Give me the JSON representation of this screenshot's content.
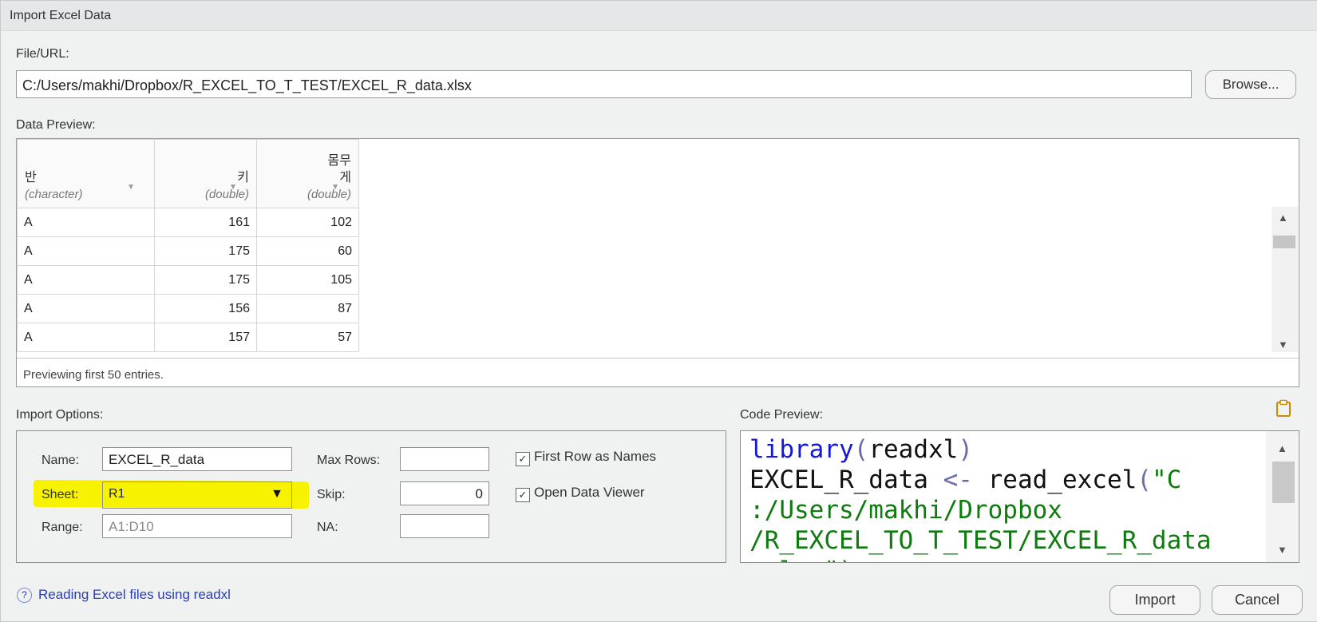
{
  "window": {
    "title": "Import Excel Data"
  },
  "file": {
    "label": "File/URL:",
    "value": "C:/Users/makhi/Dropbox/R_EXCEL_TO_T_TEST/EXCEL_R_data.xlsx",
    "browse_label": "Browse..."
  },
  "preview": {
    "label": "Data Preview:",
    "columns": [
      {
        "name": "반",
        "type": "(character)"
      },
      {
        "name": "키",
        "type": "(double)"
      },
      {
        "name": "몸무게",
        "name_line1": "몸무",
        "name_line2": "게",
        "type": "(double)"
      }
    ],
    "rows": [
      [
        "A",
        "161",
        "102"
      ],
      [
        "A",
        "175",
        "60"
      ],
      [
        "A",
        "175",
        "105"
      ],
      [
        "A",
        "156",
        "87"
      ],
      [
        "A",
        "157",
        "57"
      ]
    ],
    "footer": "Previewing first 50 entries."
  },
  "options": {
    "label": "Import Options:",
    "name_label": "Name:",
    "name_value": "EXCEL_R_data",
    "sheet_label": "Sheet:",
    "sheet_value": "R1",
    "range_label": "Range:",
    "range_placeholder": "A1:D10",
    "maxrows_label": "Max Rows:",
    "maxrows_value": "",
    "skip_label": "Skip:",
    "skip_value": "0",
    "na_label": "NA:",
    "na_value": "",
    "first_row_label": "First Row as Names",
    "first_row_checked": true,
    "open_viewer_label": "Open Data Viewer",
    "open_viewer_checked": true,
    "highlight_color": "#f6f200"
  },
  "code": {
    "label": "Code Preview:",
    "line1_fn": "library",
    "line1_open": "(",
    "line1_arg": "readxl",
    "line1_close": ")",
    "line2_var": "EXCEL_R_data",
    "line2_op": "<-",
    "line2_fn": "read_excel",
    "line2_paren": "(",
    "line2_str": "\"C",
    "line3_str": ":/Users/makhi/Dropbox",
    "line4_str": "/R_EXCEL_TO_T_TEST/EXCEL_R_data",
    "line5_str": ".xlsx\")"
  },
  "footer": {
    "help_icon": "?",
    "help_link": "Reading Excel files using readxl",
    "import_label": "Import",
    "cancel_label": "Cancel"
  },
  "icons": {
    "sort": "▼",
    "scroll_up": "▲",
    "scroll_down": "▼",
    "select_arrow": "▼",
    "check": "✓"
  }
}
